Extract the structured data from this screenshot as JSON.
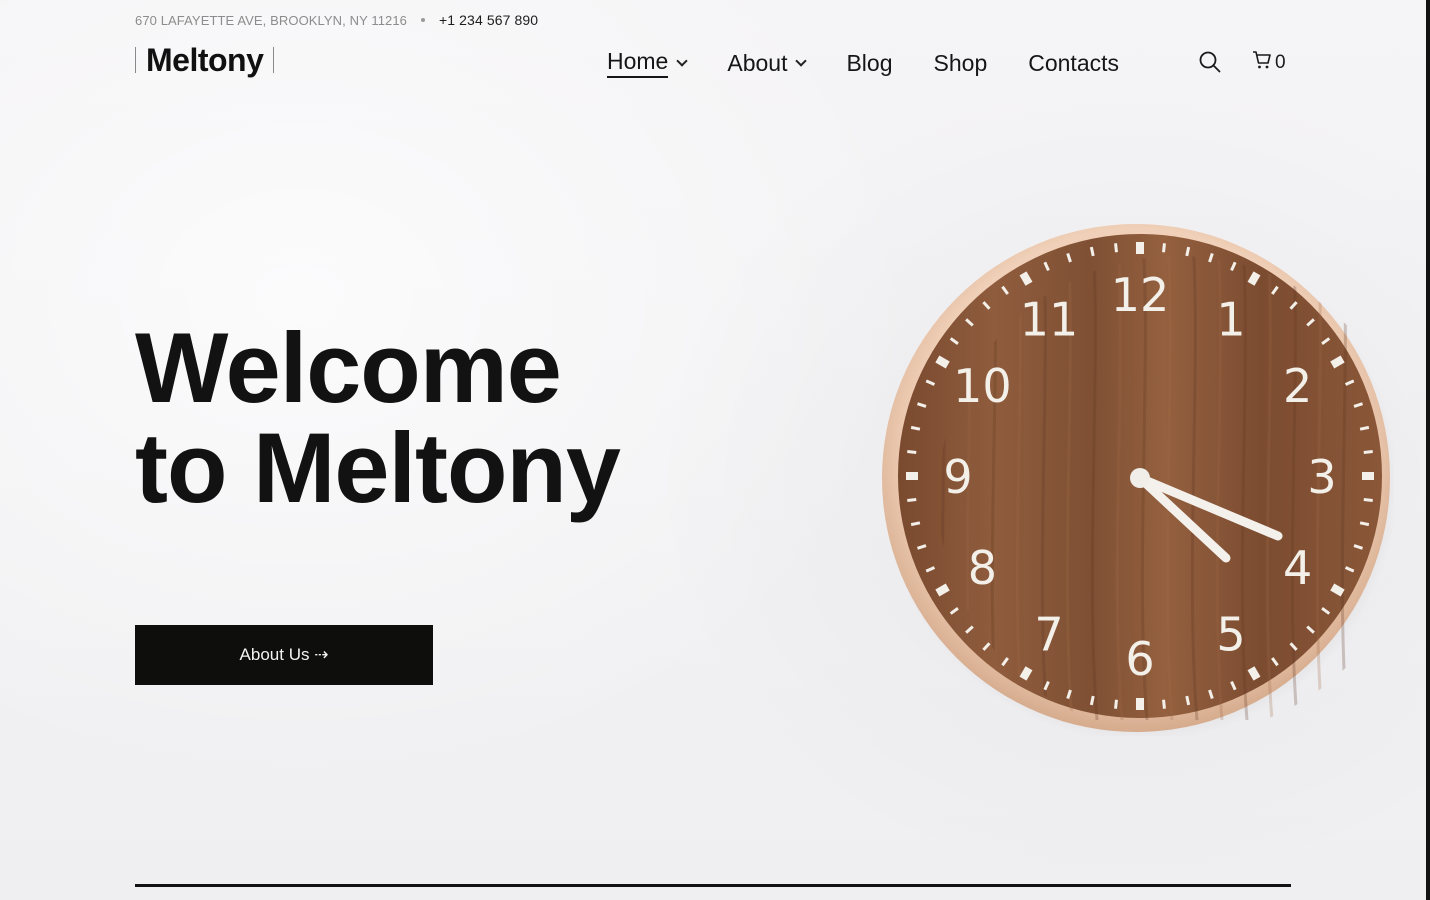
{
  "topbar": {
    "address": "670 LAFAYETTE AVE, BROOKLYN, NY 11216",
    "phone": "+1 234 567 890"
  },
  "logo": {
    "text": "Meltony"
  },
  "nav": {
    "items": [
      {
        "label": "Home",
        "active": true,
        "has_dropdown": true
      },
      {
        "label": "About",
        "active": false,
        "has_dropdown": true
      },
      {
        "label": "Blog",
        "active": false,
        "has_dropdown": false
      },
      {
        "label": "Shop",
        "active": false,
        "has_dropdown": false
      },
      {
        "label": "Contacts",
        "active": false,
        "has_dropdown": false
      }
    ],
    "search_icon": "search-icon",
    "cart_icon": "cart-icon",
    "cart_count": "0"
  },
  "hero": {
    "title_line1": "Welcome",
    "title_line2": "to Meltony",
    "cta_label": "About Us ⇢"
  },
  "clock": {
    "numerals": [
      "12",
      "1",
      "2",
      "3",
      "4",
      "5",
      "6",
      "7",
      "8",
      "9",
      "10",
      "11"
    ]
  },
  "colors": {
    "background": "#f2f2f3",
    "text": "#121212",
    "button_bg": "#0e0f0d",
    "clock_wood": "#8a5a3c",
    "clock_rim": "#e7c2a6"
  }
}
